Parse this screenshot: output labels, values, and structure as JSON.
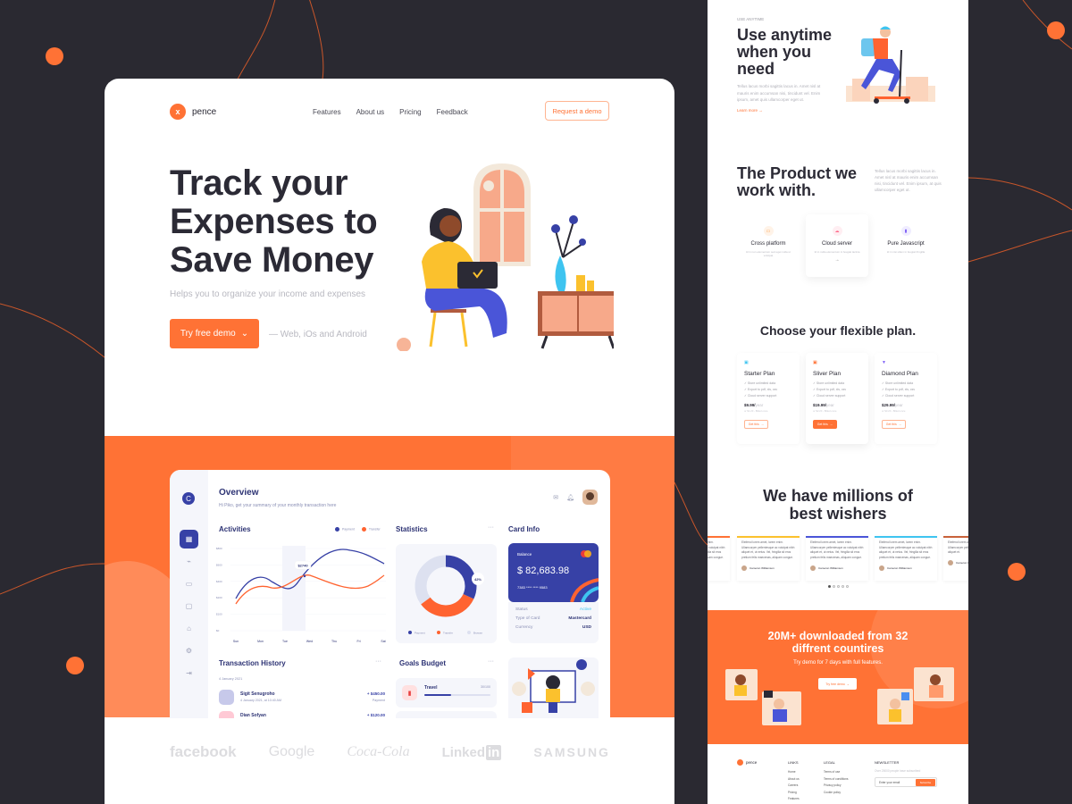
{
  "colors": {
    "accent": "#ff7235",
    "navy": "#3741a6",
    "dark_bg": "#2a2931",
    "cyan": "#3ec4f0"
  },
  "nav": {
    "logo_mark": "x",
    "logo_text": "pence",
    "links": [
      "Features",
      "About us",
      "Pricing",
      "Feedback"
    ],
    "cta": "Request a demo"
  },
  "hero": {
    "title_lines": [
      "Track your",
      "Expenses to",
      "Save Money"
    ],
    "subtitle": "Helps you to organize your income and expenses",
    "button": "Try free demo",
    "button_icon": "chevron-down-icon",
    "platforms": "— Web, iOs and Android"
  },
  "dashboard": {
    "logo_mark": "C",
    "sidebar_icons": [
      "grid-icon",
      "chart-icon",
      "wallet-icon",
      "receipt-icon",
      "bank-icon",
      "settings-icon",
      "logout-icon"
    ],
    "title": "Overview",
    "subtitle": "Hi Piko, get your summary of your monthly transaction here",
    "activities": {
      "title": "Activities",
      "legend": [
        "Payment",
        "Transfer"
      ],
      "y_ticks": [
        "$800",
        "$600",
        "$400",
        "$200",
        "$100",
        "$0"
      ],
      "x_ticks": [
        "Sun",
        "Mon",
        "Tue",
        "Wed",
        "Thu",
        "Fri",
        "Sat"
      ],
      "tooltip": "$2740"
    },
    "statistics": {
      "title": "Statistics",
      "more": "···",
      "percent_label": "42%",
      "legend": [
        "Payment",
        "Transfer",
        "Browse"
      ]
    },
    "card_info": {
      "title": "Card Info",
      "balance_label": "Balance",
      "balance": "$ 82,683.98",
      "card_number": "7383 **** **** 9583",
      "rows": [
        {
          "label": "Status",
          "value": "Active"
        },
        {
          "label": "Type of Card",
          "value": "Mastercard"
        },
        {
          "label": "Currency",
          "value": "USD"
        }
      ]
    },
    "transactions": {
      "title": "Transaction History",
      "more": "···",
      "date": "4 January 2021",
      "items": [
        {
          "name": "Sigit Senugroho",
          "time": "4 January 2021, at 10:40 AM",
          "amount": "+ $450.00",
          "type": "Payment"
        },
        {
          "name": "Dian Sofyan",
          "time": "",
          "amount": "+ $120.00",
          "type": ""
        }
      ]
    },
    "goals": {
      "title": "Goals Budget",
      "more": "···",
      "items": [
        {
          "name": "Travel",
          "value": "30/100",
          "progress": 0.4
        }
      ]
    }
  },
  "brands": [
    "facebook",
    "Google",
    "Coca-Cola",
    "Linked",
    "SAMSUNG"
  ],
  "right": {
    "eyebrow": "USE ANYTIME",
    "use_title": [
      "Use anytime",
      "when you",
      "need"
    ],
    "use_text": "Tellus lacus morbi sagittis lacus in. Amet nisl at mauris enim accumsan nisi, tincidunt vel. Enim ipsum, amet quis ullamcorper eget ut.",
    "learn_more": "Learn more →",
    "product_title": [
      "The Product we",
      "work with."
    ],
    "product_text": "Tellus lacus morbi sagittis lacus in. Amet nisl at mauris enim accumsan nisi, tincidunt vel. Enim ipsum, at quis ullamcorper eget ut.",
    "features": [
      {
        "title": "Cross platform",
        "desc": "Id in non elementum sed eget nulla ut volutpat",
        "icon": "devices-icon"
      },
      {
        "title": "Cloud server",
        "desc": "Id in nulla elementum in feugiat lacinia",
        "icon": "cloud-icon",
        "arrow": "→"
      },
      {
        "title": "Pure Javascript",
        "desc": "Id in nisi ullam in feugiat fringilla",
        "icon": "file-icon"
      }
    ],
    "plans_title": "Choose your flexible plan.",
    "plans": [
      {
        "name": "Starter Plan",
        "features": [
          "Store unlimited data",
          "Export to pdf, xls, csv",
          "Cloud server support"
        ],
        "price": "$9.99/",
        "period": "year",
        "note": "or $1.20 - Billed once",
        "button": "Get this"
      },
      {
        "name": "Sliver Plan",
        "features": [
          "Store unlimited data",
          "Export to pdf, xls, csv",
          "Cloud server support"
        ],
        "price": "$19.99/",
        "period": "year",
        "note": "or $2.20 - Billed once",
        "button": "Get this"
      },
      {
        "name": "Diamond Plan",
        "features": [
          "Store unlimited data",
          "Export to pdf, xls, csv",
          "Cloud server support"
        ],
        "price": "$29.99/",
        "period": "year",
        "note": "or $3.20 - Billed once",
        "button": "Get this"
      }
    ],
    "wishers_title": [
      "We have millions of",
      "best wishers"
    ],
    "testimonials": [
      {
        "text": "Eleifend lorem amet, lorem enim. Ullamcorper pellentesque ac volutpat nibh aliquet et, ut netus. Vel, fringilla sit eros pretium felis maecenas, aliquam congue.",
        "author": "Cameron Williamson",
        "color": "#ff7235"
      },
      {
        "text": "Eleifend lorem amet, lorem enim. Ullamcorper pellentesque ac volutpat nibh aliquet et, ut netus. Vel, fringilla sit eros pretium felis maecenas, aliquam congue.",
        "author": "Cameron Williamson",
        "color": "#fbc12d"
      },
      {
        "text": "Eleifend lorem amet, lorem enim. Ullamcorper pellentesque ac volutpat nibh aliquet et, ut netus. Vel, fringilla sit eros pretium felis maecenas, aliquam congue.",
        "author": "Cameron Williamson",
        "color": "#4a55d8"
      },
      {
        "text": "Eleifend lorem amet, lorem enim. Ullamcorper pellentesque ac volutpat nibh aliquet et, ut netus. Vel, fringilla sit eros pretium felis maecenas, aliquam congue.",
        "author": "Cameron Williamson",
        "color": "#3ec4f0"
      },
      {
        "text": "Eleifend lorem amet, lorem enim. Ullamcorper pellentesque ac volutpat nibh aliquet et.",
        "author": "Cameron Williamson",
        "color": "#c8623a"
      }
    ],
    "cta_title": [
      "20M+ downloaded from 32",
      "diffrent countires"
    ],
    "cta_text": "Try demo for 7 days with full features.",
    "cta_button": "Try free demo",
    "footer": {
      "logo_text": "pence",
      "links_title": "LINKS",
      "links": [
        "Home",
        "About us",
        "Careers",
        "Pricing",
        "Features"
      ],
      "legal_title": "LEGAL",
      "legal": [
        "Terms of use",
        "Terms of conditions",
        "Privacy policy",
        "Cookie policy"
      ],
      "newsletter_title": "NEWSLETTER",
      "newsletter_text": "Over 25000 people have subscribed",
      "email_placeholder": "Enter your email",
      "subscribe": "Subscribe"
    }
  }
}
